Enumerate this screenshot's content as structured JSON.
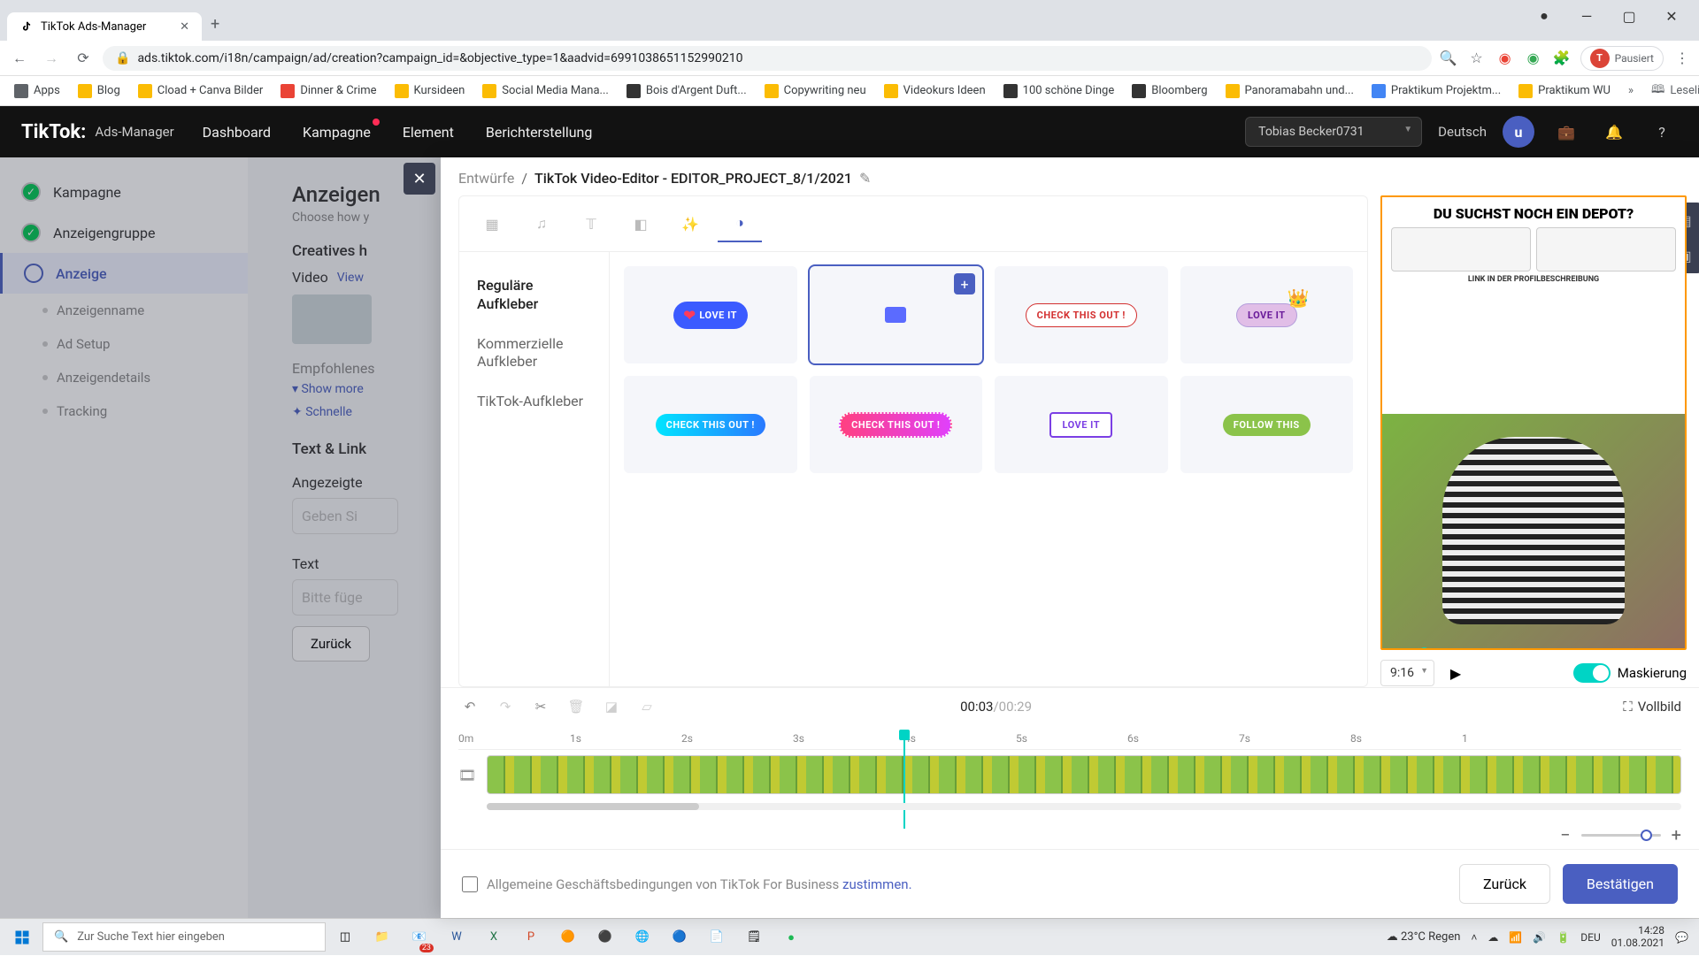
{
  "browser": {
    "tab_title": "TikTok Ads-Manager",
    "url": "ads.tiktok.com/i18n/campaign/ad/creation?campaign_id=&objective_type=1&aadvid=6991038651152990210",
    "paused_label": "Pausiert",
    "reading_list": "Leseliste",
    "bookmarks": [
      "Apps",
      "Blog",
      "Cload + Canva Bilder",
      "Dinner & Crime",
      "Kursideen",
      "Social Media Mana...",
      "Bois d'Argent Duft...",
      "Copywriting neu",
      "Videokurs Ideen",
      "100 schöne Dinge",
      "Bloomberg",
      "Panoramabahn und...",
      "Praktikum Projektm...",
      "Praktikum WU"
    ]
  },
  "header": {
    "logo_main": "TikTok:",
    "logo_sub": "Ads-Manager",
    "nav": [
      "Dashboard",
      "Kampagne",
      "Element",
      "Berichterstellung"
    ],
    "account": "Tobias Becker0731",
    "language": "Deutsch",
    "avatar_letter": "u"
  },
  "sidebar": {
    "steps": [
      {
        "label": "Kampagne",
        "done": true
      },
      {
        "label": "Anzeigengruppe",
        "done": true
      },
      {
        "label": "Anzeige",
        "active": true
      }
    ],
    "subs": [
      "Anzeigenname",
      "Ad Setup",
      "Anzeigendetails",
      "Tracking"
    ]
  },
  "bg": {
    "title": "Anzeigen",
    "sub": "Choose how y",
    "creatives": "Creatives h",
    "video": "Video",
    "view": "View",
    "empf": "Empfohlenes",
    "show_more": "Show more",
    "schnelle": "Schnelle",
    "text_link": "Text & Link",
    "angezeigt": "Angezeigte",
    "geben": "Geben Si",
    "text": "Text",
    "bitte": "Bitte füge",
    "zurueck": "Zurück"
  },
  "editor": {
    "crumb_root": "Entwürfe",
    "crumb_sep": "/",
    "crumb_title": "TikTok Video-Editor - EDITOR_PROJECT_8/1/2021",
    "cats": [
      "Reguläre Aufkleber",
      "Kommerzielle Aufkleber",
      "TikTok-Aufkleber"
    ],
    "stickers_row1": [
      "LOVE IT",
      "",
      "CHECK THIS OUT !",
      "LOVE IT"
    ],
    "stickers_row2": [
      "CHECK THIS OUT !",
      "CHECK THIS OUT !",
      "LOVE IT",
      "FOLLOW THIS"
    ],
    "aspect": "9:16",
    "mask": "Maskierung",
    "time_cur": "00:03",
    "time_tot": "/00:29",
    "fullscreen": "Vollbild",
    "ruler": [
      "0m",
      "1s",
      "2s",
      "3s",
      "4s",
      "5s",
      "6s",
      "7s",
      "8s",
      "1"
    ],
    "preview_headline": "DU SUCHST NOCH EIN DEPOT?",
    "preview_link": "LINK IN DER PROFILBESCHREIBUNG"
  },
  "footer": {
    "agb_pre": "Allgemeine Geschäftsbedingungen von TikTok For Business",
    "agb_post": " zustimmen.",
    "back": "Zurück",
    "confirm": "Bestätigen"
  },
  "taskbar": {
    "search_placeholder": "Zur Suche Text hier eingeben",
    "weather": "23°C  Regen",
    "lang": "DEU",
    "time": "14:28",
    "date": "01.08.2021",
    "mail_badge": "23"
  }
}
